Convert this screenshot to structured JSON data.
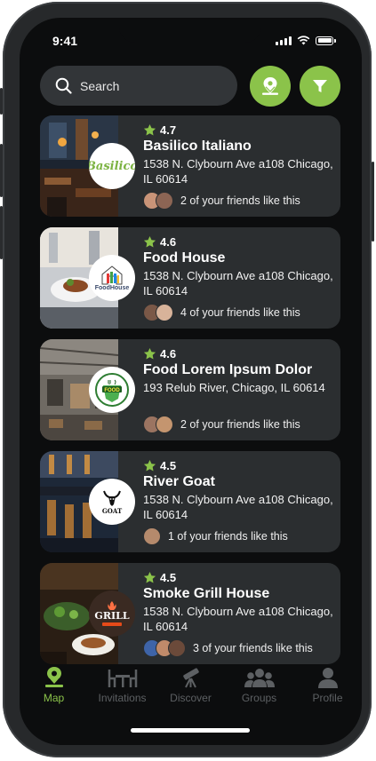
{
  "status": {
    "time": "9:41"
  },
  "search": {
    "placeholder": "Search"
  },
  "restaurants": [
    {
      "rating": "4.7",
      "name": "Basilico Italiano",
      "address": "1538 N. Clybourn Ave a108 Chicago, IL 60614",
      "friends": "2 of your friends like this",
      "logo_text": "Basilico"
    },
    {
      "rating": "4.6",
      "name": "Food House",
      "address": "1538 N. Clybourn Ave a108 Chicago, IL 60614",
      "friends": "4 of your friends like this",
      "logo_text": "FoodHouse"
    },
    {
      "rating": "4.6",
      "name": "Food Lorem Ipsum Dolor",
      "address": "193 Relub River, Chicago, IL 60614",
      "friends": "2 of your friends like this",
      "logo_text": "FOOD"
    },
    {
      "rating": "4.5",
      "name": "River Goat",
      "address": "1538 N. Clybourn Ave a108 Chicago, IL 60614",
      "friends": "1 of your friends like this",
      "logo_text": "GOAT"
    },
    {
      "rating": "4.5",
      "name": "Smoke Grill House",
      "address": "1538 N. Clybourn Ave a108 Chicago, IL 60614",
      "friends": "3 of your friends like this",
      "logo_text": "GRILL"
    }
  ],
  "tabs": [
    {
      "label": "Map",
      "icon": "map-pin-icon",
      "active": true
    },
    {
      "label": "Invitations",
      "icon": "table-icon",
      "active": false
    },
    {
      "label": "Discover",
      "icon": "telescope-icon",
      "active": false
    },
    {
      "label": "Groups",
      "icon": "groups-icon",
      "active": false
    },
    {
      "label": "Profile",
      "icon": "profile-icon",
      "active": false
    }
  ],
  "colors": {
    "accent": "#8bc34a",
    "card": "#2b2e30",
    "background": "#0c0d0e",
    "star": "#8bc34a"
  }
}
